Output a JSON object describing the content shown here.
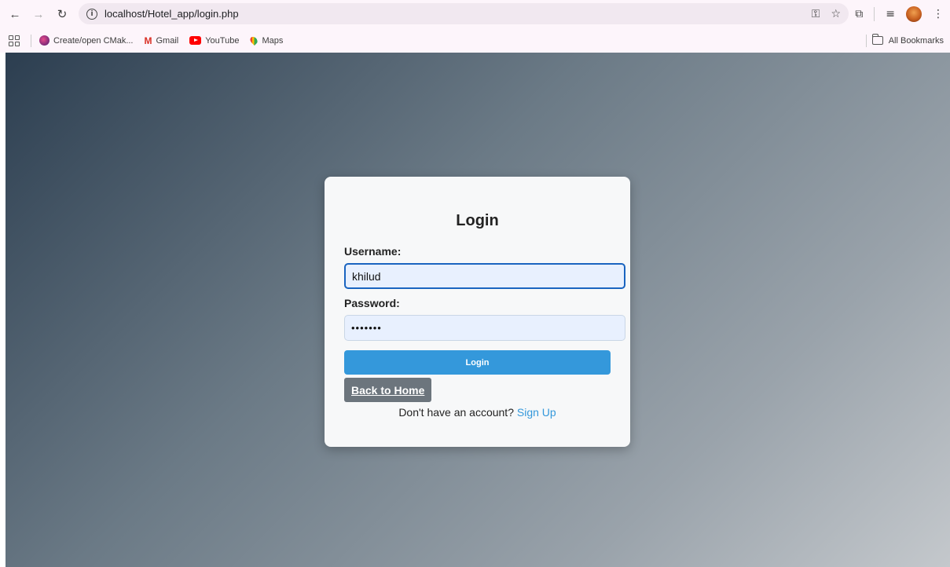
{
  "browser": {
    "url": "localhost/Hotel_app/login.php",
    "icons": {
      "back": "back-arrow-icon",
      "forward": "forward-arrow-icon",
      "reload": "reload-icon",
      "site_info": "info-icon",
      "password_key": "key-icon",
      "bookmark_star": "star-icon",
      "extensions": "puzzle-icon",
      "reading_list": "reading-list-icon",
      "menu": "kebab-menu-icon"
    },
    "bookmarks": [
      {
        "label": "Create/open CMak..."
      },
      {
        "label": "Gmail"
      },
      {
        "label": "YouTube"
      },
      {
        "label": "Maps"
      }
    ],
    "all_bookmarks": "All Bookmarks"
  },
  "login": {
    "title": "Login",
    "username_label": "Username:",
    "username_value": "khilud",
    "password_label": "Password:",
    "password_value": "•••••••",
    "login_button": "Login",
    "back_home": "Back to Home",
    "signup_prompt": "Don't have an account?",
    "signup_link": "Sign Up"
  },
  "colors": {
    "primary_button": "#3498db",
    "secondary_button": "#6c757d",
    "background_gradient_start": "#2c3e50",
    "background_gradient_end": "#c4c8cc"
  }
}
